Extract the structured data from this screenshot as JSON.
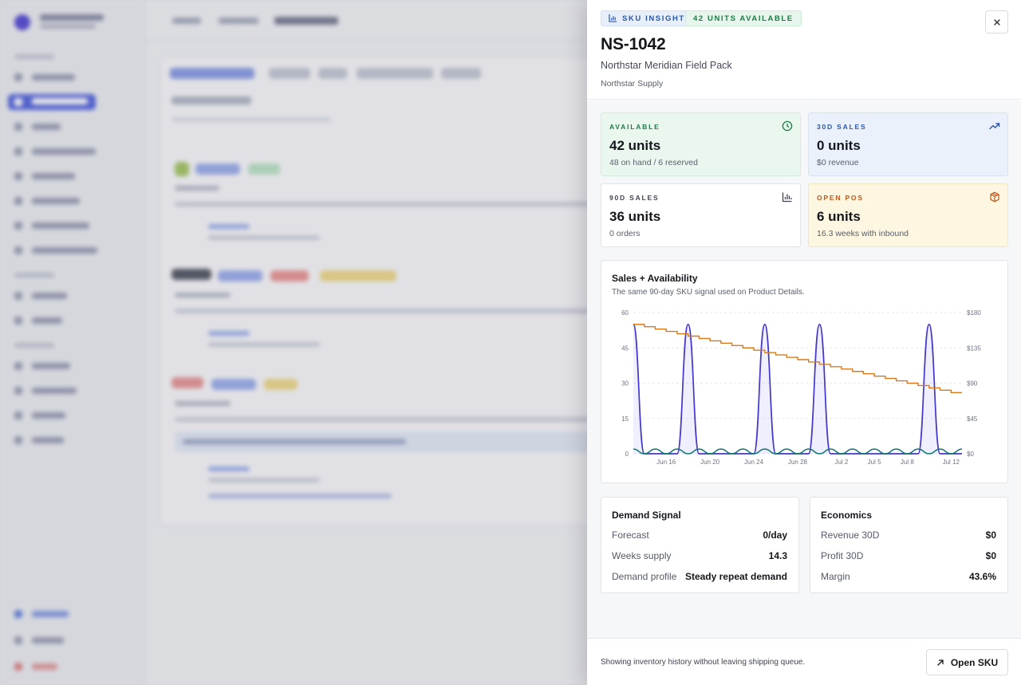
{
  "drawer": {
    "badge_insight": "SKU INSIGHT",
    "badge_units": "42 UNITS AVAILABLE",
    "sku": "NS-1042",
    "product_name": "Northstar Meridian Field Pack",
    "supplier": "Northstar Supply",
    "close_icon": "close-icon"
  },
  "stats": {
    "available": {
      "label": "AVAILABLE",
      "value": "42 units",
      "sub": "48 on hand / 6 reserved",
      "icon": "clock-icon",
      "color": "#1e7a47"
    },
    "sales30": {
      "label": "30D SALES",
      "value": "0 units",
      "sub": "$0 revenue",
      "icon": "trending-up-icon",
      "color": "#2c56a6"
    },
    "sales90": {
      "label": "90D SALES",
      "value": "36 units",
      "sub": "0 orders",
      "icon": "bar-chart-icon",
      "color": "#3f4450"
    },
    "open_pos": {
      "label": "OPEN POS",
      "value": "6 units",
      "sub": "16.3 weeks with inbound",
      "icon": "package-icon",
      "color": "#c0571b"
    }
  },
  "chart": {
    "title": "Sales + Availability",
    "subtitle": "The same 90-day SKU signal used on Product Details."
  },
  "chart_data": {
    "type": "line",
    "x": [
      "Jun 13",
      "Jun 14",
      "Jun 15",
      "Jun 16",
      "Jun 17",
      "Jun 18",
      "Jun 19",
      "Jun 20",
      "Jun 21",
      "Jun 22",
      "Jun 23",
      "Jun 24",
      "Jun 25",
      "Jun 26",
      "Jun 27",
      "Jun 28",
      "Jun 29",
      "Jun 30",
      "Jul 1",
      "Jul 2",
      "Jul 3",
      "Jul 4",
      "Jul 5",
      "Jul 6",
      "Jul 7",
      "Jul 8",
      "Jul 9",
      "Jul 10",
      "Jul 11",
      "Jul 12",
      "Jul 13"
    ],
    "x_ticks": [
      "Jun 16",
      "Jun 20",
      "Jun 24",
      "Jun 28",
      "Jul 2",
      "Jul 5",
      "Jul 8",
      "Jul 12"
    ],
    "y_left_ticks": [
      "60",
      "45",
      "30",
      "15",
      "0"
    ],
    "y_right_ticks": [
      "$180",
      "$135",
      "$90",
      "$45",
      "$0"
    ],
    "ylim_left": [
      0,
      60
    ],
    "ylim_right": [
      0,
      180
    ],
    "grid": "horizontal dashed",
    "series": [
      {
        "axis": "left",
        "color": "#4338ca",
        "values": [
          55,
          0,
          0,
          0,
          0,
          55,
          0,
          0,
          0,
          0,
          0,
          0,
          55,
          0,
          0,
          0,
          0,
          55,
          0,
          0,
          0,
          0,
          0,
          0,
          0,
          0,
          0,
          55,
          0,
          0,
          0
        ]
      },
      {
        "axis": "left",
        "color": "#d97a1a",
        "values": [
          55,
          54,
          53,
          52,
          51,
          50,
          49,
          48,
          47,
          46,
          45,
          44,
          43,
          42,
          41,
          40,
          39,
          38,
          37,
          36,
          35,
          34,
          33,
          32,
          31,
          30,
          29,
          28,
          27,
          26,
          26
        ]
      },
      {
        "axis": "left",
        "color": "#0f766e",
        "values": [
          2,
          0,
          2,
          0,
          2,
          0,
          2,
          0,
          2,
          0,
          2,
          0,
          2,
          0,
          2,
          0,
          2,
          0,
          2,
          0,
          2,
          0,
          2,
          0,
          2,
          0,
          2,
          0,
          2,
          0,
          2
        ]
      }
    ]
  },
  "demand": {
    "title": "Demand Signal",
    "rows": [
      {
        "k": "Forecast",
        "v": "0/day"
      },
      {
        "k": "Weeks supply",
        "v": "14.3"
      },
      {
        "k": "Demand profile",
        "v": "Steady repeat demand"
      }
    ]
  },
  "economics": {
    "title": "Economics",
    "rows": [
      {
        "k": "Revenue 30D",
        "v": "$0"
      },
      {
        "k": "Profit 30D",
        "v": "$0"
      },
      {
        "k": "Margin",
        "v": "43.6%"
      }
    ]
  },
  "footer": {
    "note": "Showing inventory history without leaving shipping queue.",
    "open_label": "Open SKU",
    "open_icon": "arrow-up-right-icon"
  }
}
